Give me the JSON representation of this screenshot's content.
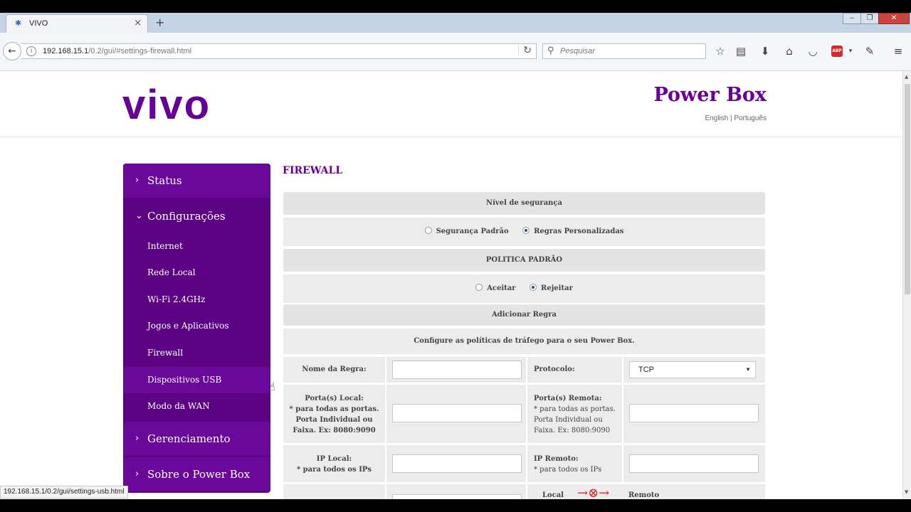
{
  "browser": {
    "tab_title": "VIVO",
    "new_tab": "+",
    "url_host": "192.168.15.1",
    "url_path": "/0.2/gui/#settings-firewall.html",
    "search_placeholder": "Pesquisar",
    "status_url": "192.168.15.1/0.2/gui/settings-usb.html",
    "abp_label": "ABP",
    "window_controls": {
      "minimize": "‒",
      "restore": "❐",
      "close": "✕"
    }
  },
  "header": {
    "logo": "vivo",
    "brand_title": "Power Box",
    "lang_english": "English",
    "lang_sep": " | ",
    "lang_portugues": "Português"
  },
  "sidebar": {
    "status": "Status",
    "configuracoes": "Configurações",
    "sub_items": [
      "Internet",
      "Rede Local",
      "Wi-Fi 2.4GHz",
      "Jogos e Aplicativos",
      "Firewall",
      "Dispositivos USB",
      "Modo da WAN"
    ],
    "gerenciamento": "Gerenciamento",
    "sobre": "Sobre o Power Box"
  },
  "firewall": {
    "title": "FIREWALL",
    "nivel_header": "Nível de segurança",
    "opt_padrao": "Segurança Padrão",
    "opt_personalizadas": "Regras Personalizadas",
    "selected_nivel": "Regras Personalizadas",
    "politica_header": "POLITICA PADRÃO",
    "opt_aceitar": "Aceitar",
    "opt_rejeitar": "Rejeitar",
    "selected_politica": "Rejeitar",
    "adicionar_header": "Adicionar Regra",
    "configure_text": "Configure as políticas de tráfego para o seu Power Box.",
    "nome_regra_label": "Nome da Regra:",
    "protocolo_label": "Protocolo:",
    "protocolo_value": "TCP",
    "porta_local_label": "Porta(s) Local:",
    "porta_local_hint": "* para todas as portas. Porta Individual ou Faixa. Ex: 8080:9090",
    "porta_remota_label": "Porta(s) Remota:",
    "porta_remota_hint": "* para todas as portas. Porta Individual ou Faixa. Ex: 8080:9090",
    "ip_local_label": "IP Local:",
    "ip_local_hint": "* para todos os IPs",
    "ip_remoto_label": "IP Remoto:",
    "ip_remoto_hint": "* para todos os IPs",
    "local_label": "Local",
    "remoto_label": "Remoto"
  }
}
